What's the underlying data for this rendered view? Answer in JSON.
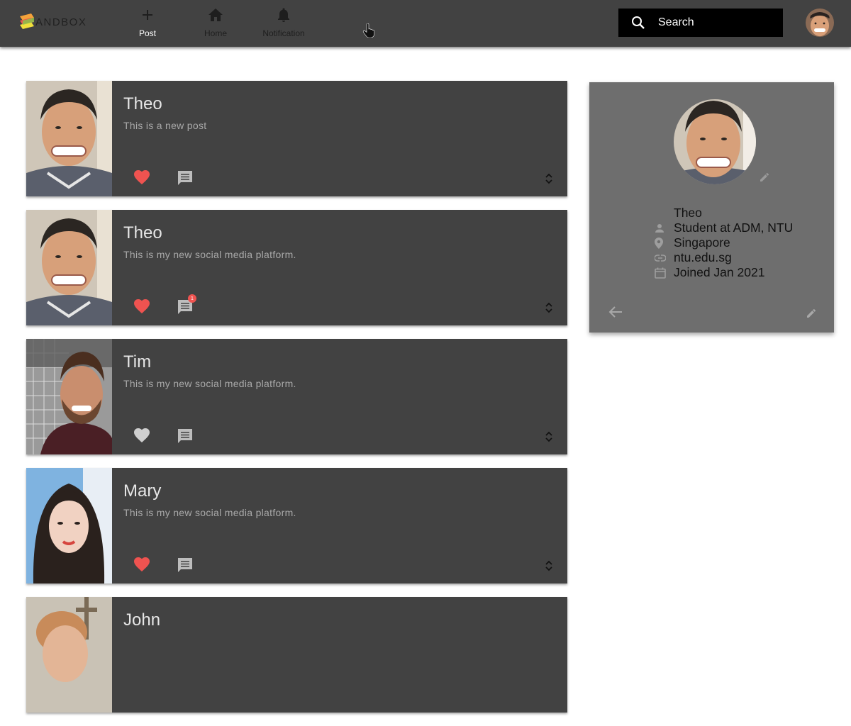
{
  "nav": {
    "logo_text": "ANDBOX",
    "post_label": "Post",
    "home_label": "Home",
    "notification_label": "Notification",
    "search_placeholder": "Search"
  },
  "posts": [
    {
      "name": "Theo",
      "body": "This is a new post",
      "liked": true,
      "comment_badge": ""
    },
    {
      "name": "Theo",
      "body": "This is my new social media platform.",
      "liked": true,
      "comment_badge": "1"
    },
    {
      "name": "Tim",
      "body": "This is my new social media platform.",
      "liked": false,
      "comment_badge": ""
    },
    {
      "name": "Mary",
      "body": "This is my new social media platform.",
      "liked": true,
      "comment_badge": ""
    },
    {
      "name": "John",
      "body": "",
      "liked": false,
      "comment_badge": ""
    }
  ],
  "profile": {
    "name": "Theo",
    "bio": "Student at ADM, NTU",
    "location": "Singapore",
    "website": "ntu.edu.sg",
    "joined": "Joined Jan 2021"
  },
  "colors": {
    "navbar": "#424242",
    "card": "#424242",
    "profile_card": "#6e6e6e",
    "like_active": "#ef5350",
    "like_inactive": "#cfcfcf",
    "icon_grey": "#bdbdbd"
  }
}
